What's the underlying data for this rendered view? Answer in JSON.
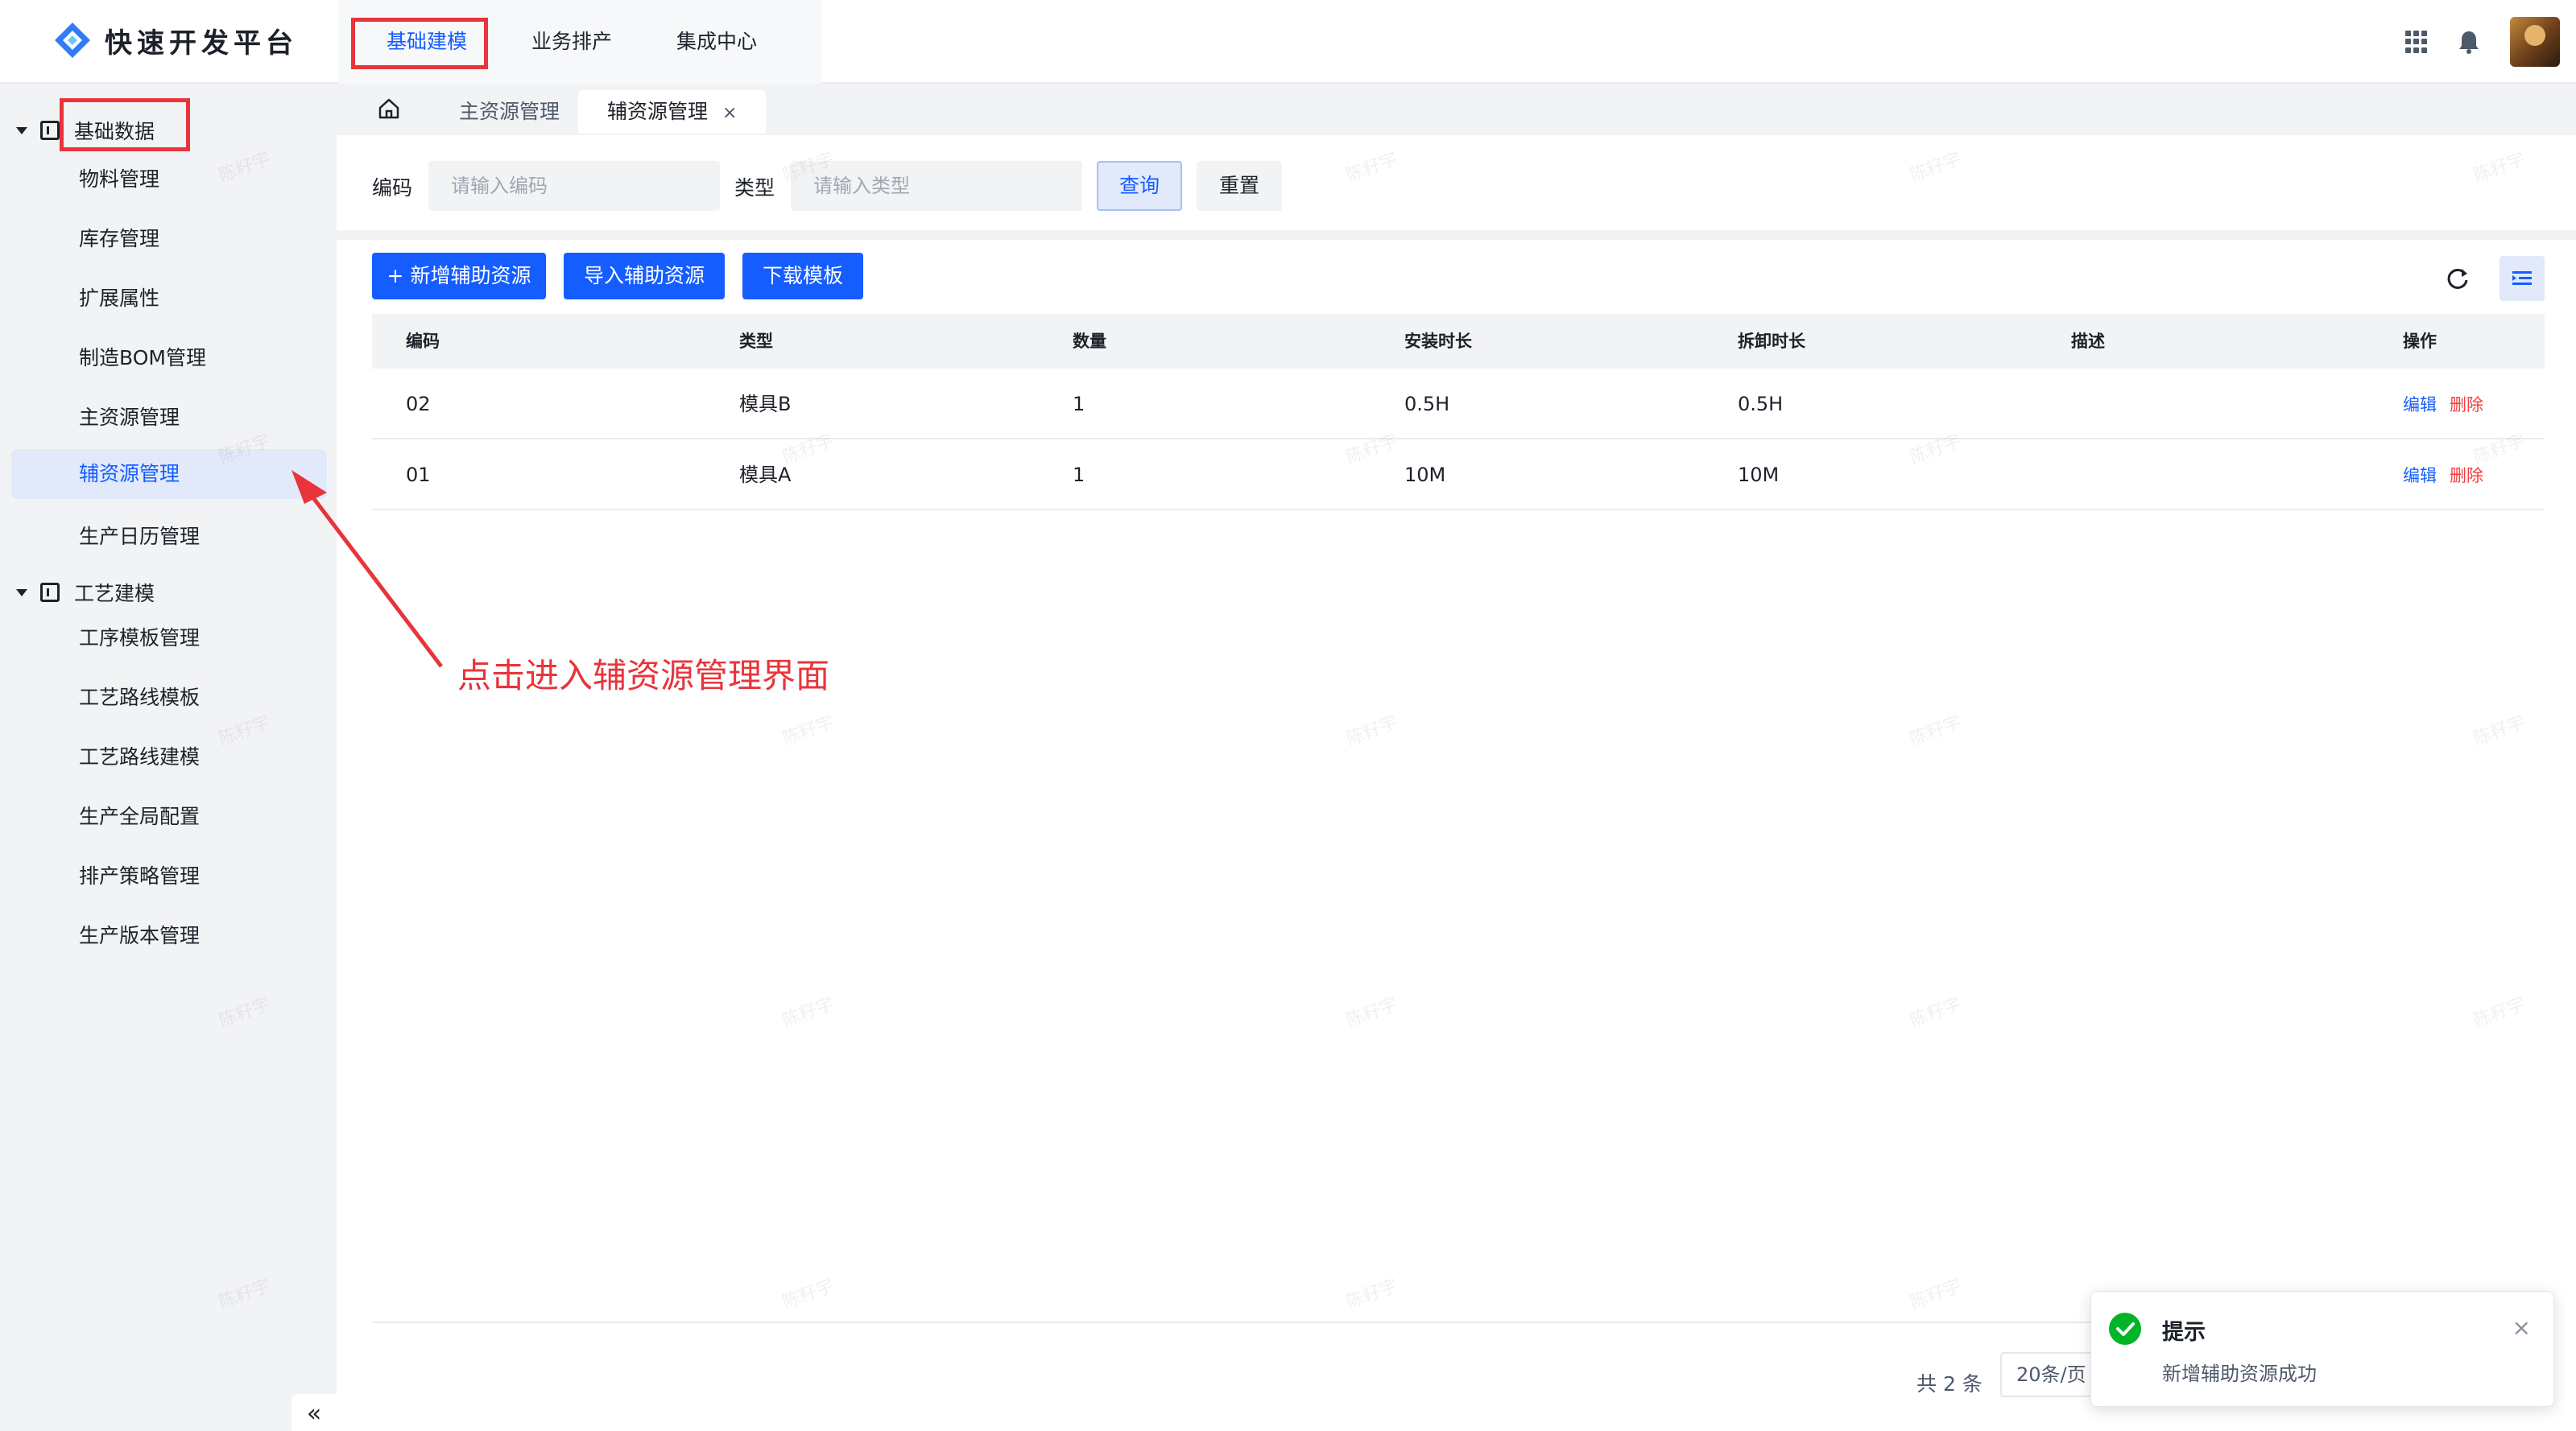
{
  "app": {
    "title": "快速开发平台"
  },
  "top_nav": {
    "items": [
      {
        "label": "基础建模",
        "active": true
      },
      {
        "label": "业务排产",
        "active": false
      },
      {
        "label": "集成中心",
        "active": false
      }
    ],
    "icons": [
      "apps-grid-icon",
      "bell-icon",
      "user-avatar"
    ]
  },
  "sidebar": {
    "groups": [
      {
        "label": "基础数据",
        "icon": "data-icon",
        "items": [
          "物料管理",
          "库存管理",
          "扩展属性",
          "制造BOM管理",
          "主资源管理",
          "辅资源管理",
          "生产日历管理"
        ]
      },
      {
        "label": "工艺建模",
        "icon": "process-icon",
        "items": [
          "工序模板管理",
          "工艺路线模板",
          "工艺路线建模",
          "生产全局配置",
          "排产策略管理",
          "生产版本管理"
        ]
      }
    ],
    "active_item": "辅资源管理",
    "collapse_label": "«"
  },
  "tabs": {
    "items": [
      {
        "label": "主资源管理",
        "active": false,
        "closable": false
      },
      {
        "label": "辅资源管理",
        "active": true,
        "closable": true
      }
    ],
    "close_glyph": "×"
  },
  "search": {
    "code_label": "编码",
    "code_placeholder": "请输入编码",
    "type_label": "类型",
    "type_placeholder": "请输入类型",
    "query_label": "查询",
    "reset_label": "重置"
  },
  "toolbar": {
    "add_label": "+ 新增辅助资源",
    "import_label": "导入辅助资源",
    "download_label": "下载模板"
  },
  "table": {
    "columns": [
      "编码",
      "类型",
      "数量",
      "安装时长",
      "拆卸时长",
      "描述",
      "操作"
    ],
    "rows": [
      {
        "code": "02",
        "type": "模具B",
        "qty": "1",
        "install": "0.5H",
        "remove": "0.5H",
        "desc": "",
        "edit": "编辑",
        "delete": "删除"
      },
      {
        "code": "01",
        "type": "模具A",
        "qty": "1",
        "install": "10M",
        "remove": "10M",
        "desc": "",
        "edit": "编辑",
        "delete": "删除"
      }
    ]
  },
  "pagination": {
    "total": "共 2 条",
    "page_size": "20条/页"
  },
  "toast": {
    "title": "提示",
    "message": "新增辅助资源成功",
    "close_glyph": "×",
    "status_color": "#00b42a"
  },
  "annotation": {
    "text": "点击进入辅资源管理界面",
    "color": "#e8343b"
  },
  "watermark": "陈籽宇",
  "colors": {
    "primary": "#165dff",
    "danger": "#f53f3f",
    "success": "#00b42a"
  }
}
